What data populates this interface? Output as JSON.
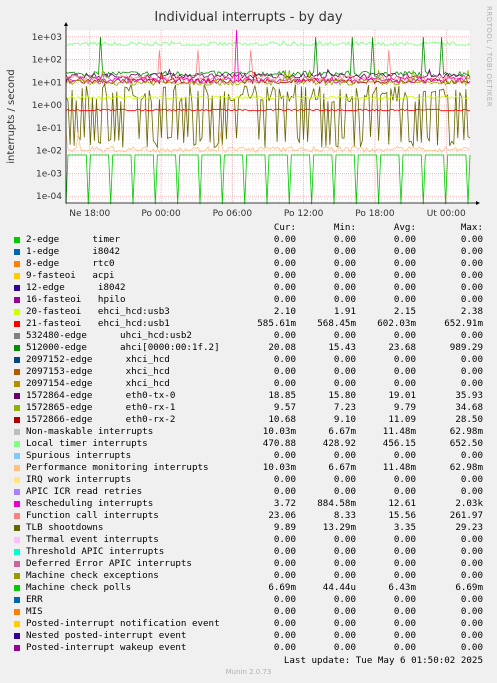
{
  "title": "Individual interrupts - by day",
  "side_note": "RRDTOOL / TOBI OETIKER",
  "footer": "Munin 2.0.73",
  "last_update": "Last update:  Tue May  6 01:50:02 2025",
  "legend_header": {
    "cur": "Cur:",
    "min": "Min:",
    "avg": "Avg:",
    "max": "Max:"
  },
  "legend": [
    {
      "label": "2-edge      timer",
      "color": "#00cc00",
      "cur": "0.00",
      "min": "0.00",
      "avg": "0.00",
      "max": "0.00"
    },
    {
      "label": "1-edge      i8042",
      "color": "#0066b3",
      "cur": "0.00",
      "min": "0.00",
      "avg": "0.00",
      "max": "0.00"
    },
    {
      "label": "8-edge      rtc0",
      "color": "#ff8000",
      "cur": "0.00",
      "min": "0.00",
      "avg": "0.00",
      "max": "0.00"
    },
    {
      "label": "9-fasteoi   acpi",
      "color": "#ffcc00",
      "cur": "0.00",
      "min": "0.00",
      "avg": "0.00",
      "max": "0.00"
    },
    {
      "label": "12-edge      i8042",
      "color": "#330099",
      "cur": "0.00",
      "min": "0.00",
      "avg": "0.00",
      "max": "0.00"
    },
    {
      "label": "16-fasteoi   hpilo",
      "color": "#990099",
      "cur": "0.00",
      "min": "0.00",
      "avg": "0.00",
      "max": "0.00"
    },
    {
      "label": "20-fasteoi   ehci_hcd:usb3",
      "color": "#ccff00",
      "cur": "2.10",
      "min": "1.91",
      "avg": "2.15",
      "max": "2.38"
    },
    {
      "label": "21-fasteoi   ehci_hcd:usb1",
      "color": "#ff0000",
      "cur": "585.61m",
      "min": "568.45m",
      "avg": "602.03m",
      "max": "652.91m"
    },
    {
      "label": "532480-edge      uhci_hcd:usb2",
      "color": "#808080",
      "cur": "0.00",
      "min": "0.00",
      "avg": "0.00",
      "max": "0.00"
    },
    {
      "label": "512000-edge      ahci[0000:00:1f.2]",
      "color": "#008f00",
      "cur": "20.08",
      "min": "15.43",
      "avg": "23.68",
      "max": "989.29"
    },
    {
      "label": "2097152-edge      xhci_hcd",
      "color": "#00487d",
      "cur": "0.00",
      "min": "0.00",
      "avg": "0.00",
      "max": "0.00"
    },
    {
      "label": "2097153-edge      xhci_hcd",
      "color": "#b35a00",
      "cur": "0.00",
      "min": "0.00",
      "avg": "0.00",
      "max": "0.00"
    },
    {
      "label": "2097154-edge      xhci_hcd",
      "color": "#b38f00",
      "cur": "0.00",
      "min": "0.00",
      "avg": "0.00",
      "max": "0.00"
    },
    {
      "label": "1572864-edge      eth0-tx-0",
      "color": "#6b006b",
      "cur": "18.85",
      "min": "15.80",
      "avg": "19.01",
      "max": "35.93"
    },
    {
      "label": "1572865-edge      eth0-rx-1",
      "color": "#8fb300",
      "cur": "9.57",
      "min": "7.23",
      "avg": "9.79",
      "max": "34.68"
    },
    {
      "label": "1572866-edge      eth0-rx-2",
      "color": "#b30000",
      "cur": "10.68",
      "min": "9.10",
      "avg": "11.09",
      "max": "28.50"
    },
    {
      "label": "Non-maskable interrupts",
      "color": "#bebebe",
      "cur": "10.03m",
      "min": "6.67m",
      "avg": "11.48m",
      "max": "62.98m"
    },
    {
      "label": "Local timer interrupts",
      "color": "#80ff80",
      "cur": "470.88",
      "min": "428.92",
      "avg": "456.15",
      "max": "652.50"
    },
    {
      "label": "Spurious interrupts",
      "color": "#80c9ff",
      "cur": "0.00",
      "min": "0.00",
      "avg": "0.00",
      "max": "0.00"
    },
    {
      "label": "Performance monitoring interrupts",
      "color": "#ffc080",
      "cur": "10.03m",
      "min": "6.67m",
      "avg": "11.48m",
      "max": "62.98m"
    },
    {
      "label": "IRQ work interrupts",
      "color": "#ffe680",
      "cur": "0.00",
      "min": "0.00",
      "avg": "0.00",
      "max": "0.00"
    },
    {
      "label": "APIC ICR read retries",
      "color": "#aa80ff",
      "cur": "0.00",
      "min": "0.00",
      "avg": "0.00",
      "max": "0.00"
    },
    {
      "label": "Rescheduling interrupts",
      "color": "#ee00cc",
      "cur": "3.72",
      "min": "884.58m",
      "avg": "12.61",
      "max": "2.03k"
    },
    {
      "label": "Function call interrupts",
      "color": "#ff8080",
      "cur": "23.06",
      "min": "8.33",
      "avg": "15.56",
      "max": "261.97"
    },
    {
      "label": "TLB shootdowns",
      "color": "#666600",
      "cur": "9.89",
      "min": "13.29m",
      "avg": "3.35",
      "max": "29.23"
    },
    {
      "label": "Thermal event interrupts",
      "color": "#ffbfff",
      "cur": "0.00",
      "min": "0.00",
      "avg": "0.00",
      "max": "0.00"
    },
    {
      "label": "Threshold APIC interrupts",
      "color": "#00ffcc",
      "cur": "0.00",
      "min": "0.00",
      "avg": "0.00",
      "max": "0.00"
    },
    {
      "label": "Deferred Error APIC interrupts",
      "color": "#cc6699",
      "cur": "0.00",
      "min": "0.00",
      "avg": "0.00",
      "max": "0.00"
    },
    {
      "label": "Machine check exceptions",
      "color": "#999900",
      "cur": "0.00",
      "min": "0.00",
      "avg": "0.00",
      "max": "0.00"
    },
    {
      "label": "Machine check polls",
      "color": "#00cc00",
      "cur": "6.69m",
      "min": "44.44u",
      "avg": "6.43m",
      "max": "6.69m"
    },
    {
      "label": "ERR",
      "color": "#0066b3",
      "cur": "0.00",
      "min": "0.00",
      "avg": "0.00",
      "max": "0.00"
    },
    {
      "label": "MIS",
      "color": "#ff8000",
      "cur": "0.00",
      "min": "0.00",
      "avg": "0.00",
      "max": "0.00"
    },
    {
      "label": "Posted-interrupt notification event",
      "color": "#ffcc00",
      "cur": "0.00",
      "min": "0.00",
      "avg": "0.00",
      "max": "0.00"
    },
    {
      "label": "Nested posted-interrupt event",
      "color": "#330099",
      "cur": "0.00",
      "min": "0.00",
      "avg": "0.00",
      "max": "0.00"
    },
    {
      "label": "Posted-interrupt wakeup event",
      "color": "#990099",
      "cur": "0.00",
      "min": "0.00",
      "avg": "0.00",
      "max": "0.00"
    }
  ],
  "chart_data": {
    "type": "line",
    "title": "Individual interrupts - by day",
    "ylabel": "interrupts / second",
    "yscale": "log",
    "ylim": [
      5e-05,
      2000
    ],
    "ytick_labels": [
      "1e+03",
      "1e+02",
      "1e+01",
      "1e+00",
      "1e-01",
      "1e-02",
      "1e-03",
      "1e-04"
    ],
    "ytick_values": [
      1000,
      100,
      10,
      1,
      0.1,
      0.01,
      0.001,
      0.0001
    ],
    "x_range": [
      "Mon 16:00",
      "Tue 02:00"
    ],
    "xtick_labels": [
      "Ne 18:00",
      "Po 00:00",
      "Po 06:00",
      "Po 12:00",
      "Po 18:00",
      "Ut 00:00"
    ],
    "xtick_values": [
      "Sun 18:00",
      "Mon 00:00",
      "Mon 06:00",
      "Mon 12:00",
      "Mon 18:00",
      "Tue 00:00"
    ],
    "grid": true,
    "series": [
      {
        "name": "Local timer interrupts",
        "color": "#80ff80",
        "level": 456.15,
        "min": 428.92,
        "max": 652.5
      },
      {
        "name": "512000-edge      ahci[0000:00:1f.2]",
        "color": "#008f00",
        "level": 23.68,
        "min": 15.43,
        "max": 989.29
      },
      {
        "name": "1572864-edge      eth0-tx-0",
        "color": "#6b006b",
        "level": 19.01,
        "min": 15.8,
        "max": 35.93
      },
      {
        "name": "Function call interrupts",
        "color": "#ff8080",
        "level": 15.56,
        "min": 8.33,
        "max": 261.97
      },
      {
        "name": "1572866-edge      eth0-rx-2",
        "color": "#b30000",
        "level": 11.09,
        "min": 9.1,
        "max": 28.5
      },
      {
        "name": "Rescheduling interrupts",
        "color": "#ee00cc",
        "level": 12.61,
        "min": 0.88458,
        "max": 2030
      },
      {
        "name": "1572865-edge      eth0-rx-1",
        "color": "#8fb300",
        "level": 9.79,
        "min": 7.23,
        "max": 34.68
      },
      {
        "name": "TLB shootdowns",
        "color": "#666600",
        "level": 3.35,
        "min": 0.01329,
        "max": 29.23
      },
      {
        "name": "20-fasteoi   ehci_hcd:usb3",
        "color": "#ccff00",
        "level": 2.15,
        "min": 1.91,
        "max": 2.38
      },
      {
        "name": "21-fasteoi   ehci_hcd:usb1",
        "color": "#ff0000",
        "level": 0.60203,
        "min": 0.56845,
        "max": 0.65291
      },
      {
        "name": "Performance monitoring interrupts",
        "color": "#ffc080",
        "level": 0.01148,
        "min": 0.00667,
        "max": 0.06298
      },
      {
        "name": "Machine check polls",
        "color": "#00cc00",
        "level": 0.00643,
        "min": 4.44e-05,
        "max": 0.00669
      }
    ]
  }
}
